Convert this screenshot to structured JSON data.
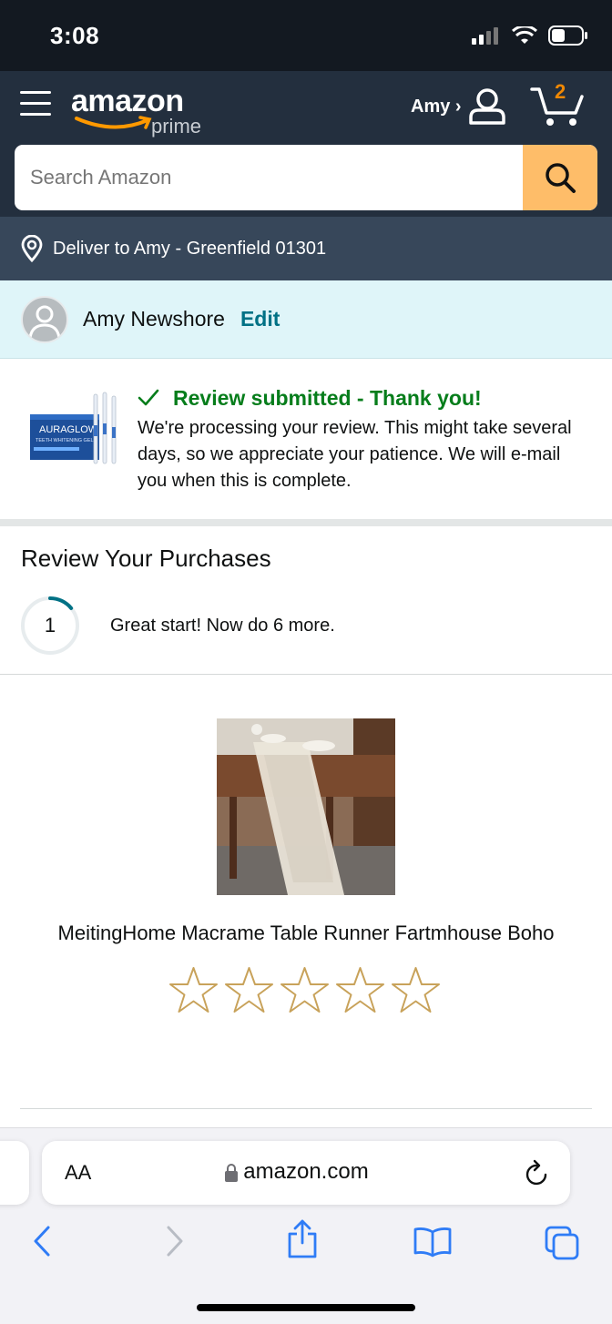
{
  "status_bar": {
    "time": "3:08"
  },
  "header": {
    "logo_word": "amazon",
    "logo_sub": "prime",
    "account_label": "Amy ›",
    "cart_count": "2"
  },
  "search": {
    "placeholder": "Search Amazon"
  },
  "deliver": {
    "label": "Deliver to Amy - Greenfield 01301"
  },
  "profile": {
    "name": "Amy Newshore",
    "edit_label": "Edit"
  },
  "confirmation": {
    "title": "Review submitted - Thank you!",
    "body": "We're processing your review. This might take several days, so we appreciate your patience. We will e-mail you when this is complete.",
    "thumb_brand": "AURAGLOW",
    "thumb_sub": "TEETH WHITENING GEL"
  },
  "review_purchases": {
    "title": "Review Your Purchases",
    "progress_count": "1",
    "progress_fraction": 0.14,
    "progress_text": "Great start! Now do 6 more."
  },
  "product": {
    "title": "MeitingHome Macrame Table Runner Fartmhouse Boho",
    "rating_stars_total": 5,
    "rating_selected": 0
  },
  "browser": {
    "aa_label": "AA",
    "url": "amazon.com"
  },
  "colors": {
    "header_bg": "#232f3e",
    "search_button": "#febd69",
    "success_green": "#067d1b",
    "link_teal": "#007185",
    "star_outline": "#c8a25a",
    "ios_blue": "#2f7cf6"
  }
}
